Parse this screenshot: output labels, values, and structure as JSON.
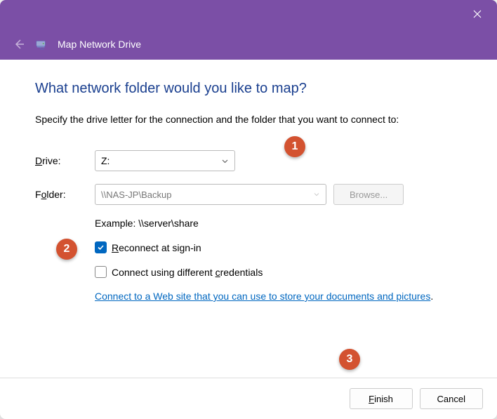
{
  "titlebar": {
    "app_title": "Map Network Drive"
  },
  "heading": "What network folder would you like to map?",
  "subtitle": "Specify the drive letter for the connection and the folder that you want to connect to:",
  "form": {
    "drive_label_before": "",
    "drive_label_u": "D",
    "drive_label_after": "rive:",
    "drive_value": "Z:",
    "folder_label_before": "F",
    "folder_label_u": "o",
    "folder_label_after": "lder:",
    "folder_value": "\\\\NAS-JP\\Backup",
    "browse_before": "",
    "browse_u": "B",
    "browse_after": "rowse...",
    "example": "Example: \\\\server\\share"
  },
  "checkboxes": {
    "reconnect_before": "",
    "reconnect_u": "R",
    "reconnect_after": "econnect at sign-in",
    "credentials_before": "Connect using different ",
    "credentials_u": "c",
    "credentials_after": "redentials"
  },
  "link": "Connect to a Web site that you can use to store your documents and pictures",
  "footer": {
    "finish_before": "",
    "finish_u": "F",
    "finish_after": "inish",
    "cancel": "Cancel"
  },
  "badges": {
    "b1": "1",
    "b2": "2",
    "b3": "3"
  }
}
